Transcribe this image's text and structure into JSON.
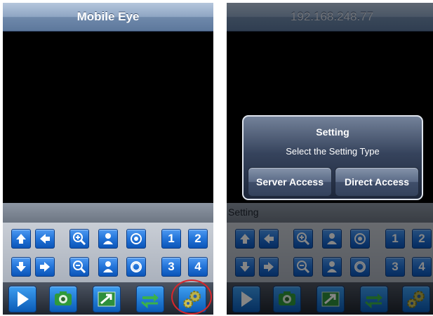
{
  "left_screen": {
    "title": "Mobile Eye",
    "ptz_buttons": [
      {
        "row": 0,
        "col": 0,
        "icon": "arrow-up-icon"
      },
      {
        "row": 0,
        "col": 1,
        "icon": "arrow-left-icon"
      },
      {
        "row": 0,
        "col": 2,
        "icon": "zoom-in-icon"
      },
      {
        "row": 0,
        "col": 3,
        "icon": "focus-near-icon"
      },
      {
        "row": 0,
        "col": 4,
        "icon": "iris-open-icon"
      },
      {
        "row": 0,
        "col": 5,
        "label": "1"
      },
      {
        "row": 0,
        "col": 6,
        "label": "2"
      },
      {
        "row": 1,
        "col": 0,
        "icon": "arrow-down-icon"
      },
      {
        "row": 1,
        "col": 1,
        "icon": "arrow-right-icon"
      },
      {
        "row": 1,
        "col": 2,
        "icon": "zoom-out-icon"
      },
      {
        "row": 1,
        "col": 3,
        "icon": "focus-far-icon"
      },
      {
        "row": 1,
        "col": 4,
        "icon": "iris-close-icon"
      },
      {
        "row": 1,
        "col": 5,
        "label": "3"
      },
      {
        "row": 1,
        "col": 6,
        "label": "4"
      }
    ],
    "toolbar": [
      "play-icon",
      "snapshot-camera-icon",
      "image-gallery-icon",
      "switch-layout-icon",
      "settings-gears-icon"
    ],
    "highlighted": "settings-gears-icon",
    "highlight_color": "#d7262c"
  },
  "right_screen": {
    "title": "192.168.248.77",
    "status_text": "Setting",
    "dialog": {
      "title": "Setting",
      "message": "Select the Setting Type",
      "buttons": {
        "server": "Server Access",
        "direct": "Direct Access"
      }
    }
  },
  "colors": {
    "button_blue": "#2273d8",
    "titlebar": "#7f97b8"
  }
}
